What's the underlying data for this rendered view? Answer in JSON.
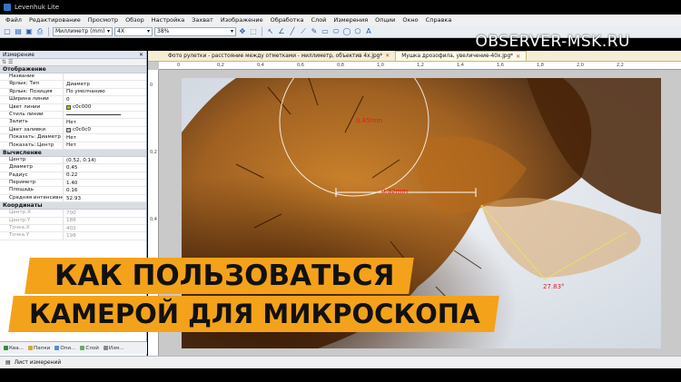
{
  "window": {
    "title": "Levenhuk Lite"
  },
  "menu": [
    "Файл",
    "Редактирование",
    "Просмотр",
    "Обзор",
    "Настройка",
    "Захват",
    "Изображение",
    "Обработка",
    "Слой",
    "Измерения",
    "Опции",
    "Окно",
    "Справка"
  ],
  "toolbar": {
    "unit": "Миллиметр (mm)",
    "objective": "4X",
    "zoom": "38%"
  },
  "watermark": "OBSERVER-MSK.RU",
  "left_panel": {
    "title": "Измерение",
    "sections": [
      {
        "name": "Отображение",
        "rows": [
          {
            "k": "Название",
            "v": ""
          },
          {
            "k": "Ярлык: Тип",
            "v": "Диаметр"
          },
          {
            "k": "Ярлык: Позиция",
            "v": "По умолчанию"
          },
          {
            "k": "Ширина линии",
            "v": "0"
          },
          {
            "k": "Цвет линии",
            "v": "c0c000",
            "swatch": "#c0c000"
          },
          {
            "k": "Стиль линии",
            "v": ""
          },
          {
            "k": "Залить",
            "v": "Нет"
          },
          {
            "k": "Цвет заливки",
            "v": "c0c0c0",
            "swatch": "#c0c0c0"
          },
          {
            "k": "Показать: Диаметр / ...",
            "v": "Нет"
          },
          {
            "k": "Показать: Центр",
            "v": "Нет"
          }
        ]
      },
      {
        "name": "Вычисление",
        "rows": [
          {
            "k": "Центр",
            "v": "(0.52, 0.14)"
          },
          {
            "k": "Диаметр",
            "v": "0.45"
          },
          {
            "k": "Радиус",
            "v": "0.22"
          },
          {
            "k": "Периметр",
            "v": "1.40"
          },
          {
            "k": "Площадь",
            "v": "0.16"
          },
          {
            "k": "Средняя интенсивно...",
            "v": "52.93"
          }
        ]
      },
      {
        "name": "Координаты",
        "rows": [
          {
            "k": "Центр.X",
            "v": "700",
            "faded": true
          },
          {
            "k": "Центр.Y",
            "v": "188",
            "faded": true
          },
          {
            "k": "Точка.X",
            "v": "402",
            "faded": true
          },
          {
            "k": "Точка.Y",
            "v": "198",
            "faded": true
          }
        ]
      }
    ],
    "tabs": [
      "Ква...",
      "Папки",
      "Опи...",
      "Слой",
      "Изм..."
    ]
  },
  "doc_tabs": [
    {
      "label": "Фото рулетки - расстояние между отметками - миллиметр, объектив 4х.jpg*",
      "active": false
    },
    {
      "label": "Мушка дрозофила, увеличение-40х.jpg*",
      "active": true
    }
  ],
  "ruler": {
    "h": [
      "0",
      "0,2",
      "0,4",
      "0,6",
      "0,8",
      "1,0",
      "1,2",
      "1,4",
      "1,6",
      "1,8",
      "2,0",
      "2,2"
    ],
    "v": [
      "0",
      "0,2",
      "0,4"
    ]
  },
  "measurements": {
    "diameter": "0.45mm",
    "line": "0.32mm",
    "angle": "27.83°"
  },
  "status": {
    "label": "Лист измерений"
  },
  "banner": {
    "line1": "КАК ПОЛЬЗОВАТЬСЯ",
    "line2": "КАМЕРОЙ ДЛЯ МИКРОСКОПА"
  },
  "colors": {
    "banner": "#f4a21a",
    "measure_line": "#ffffff",
    "angle_line": "#e8e060",
    "measure_text": "#e02020"
  }
}
